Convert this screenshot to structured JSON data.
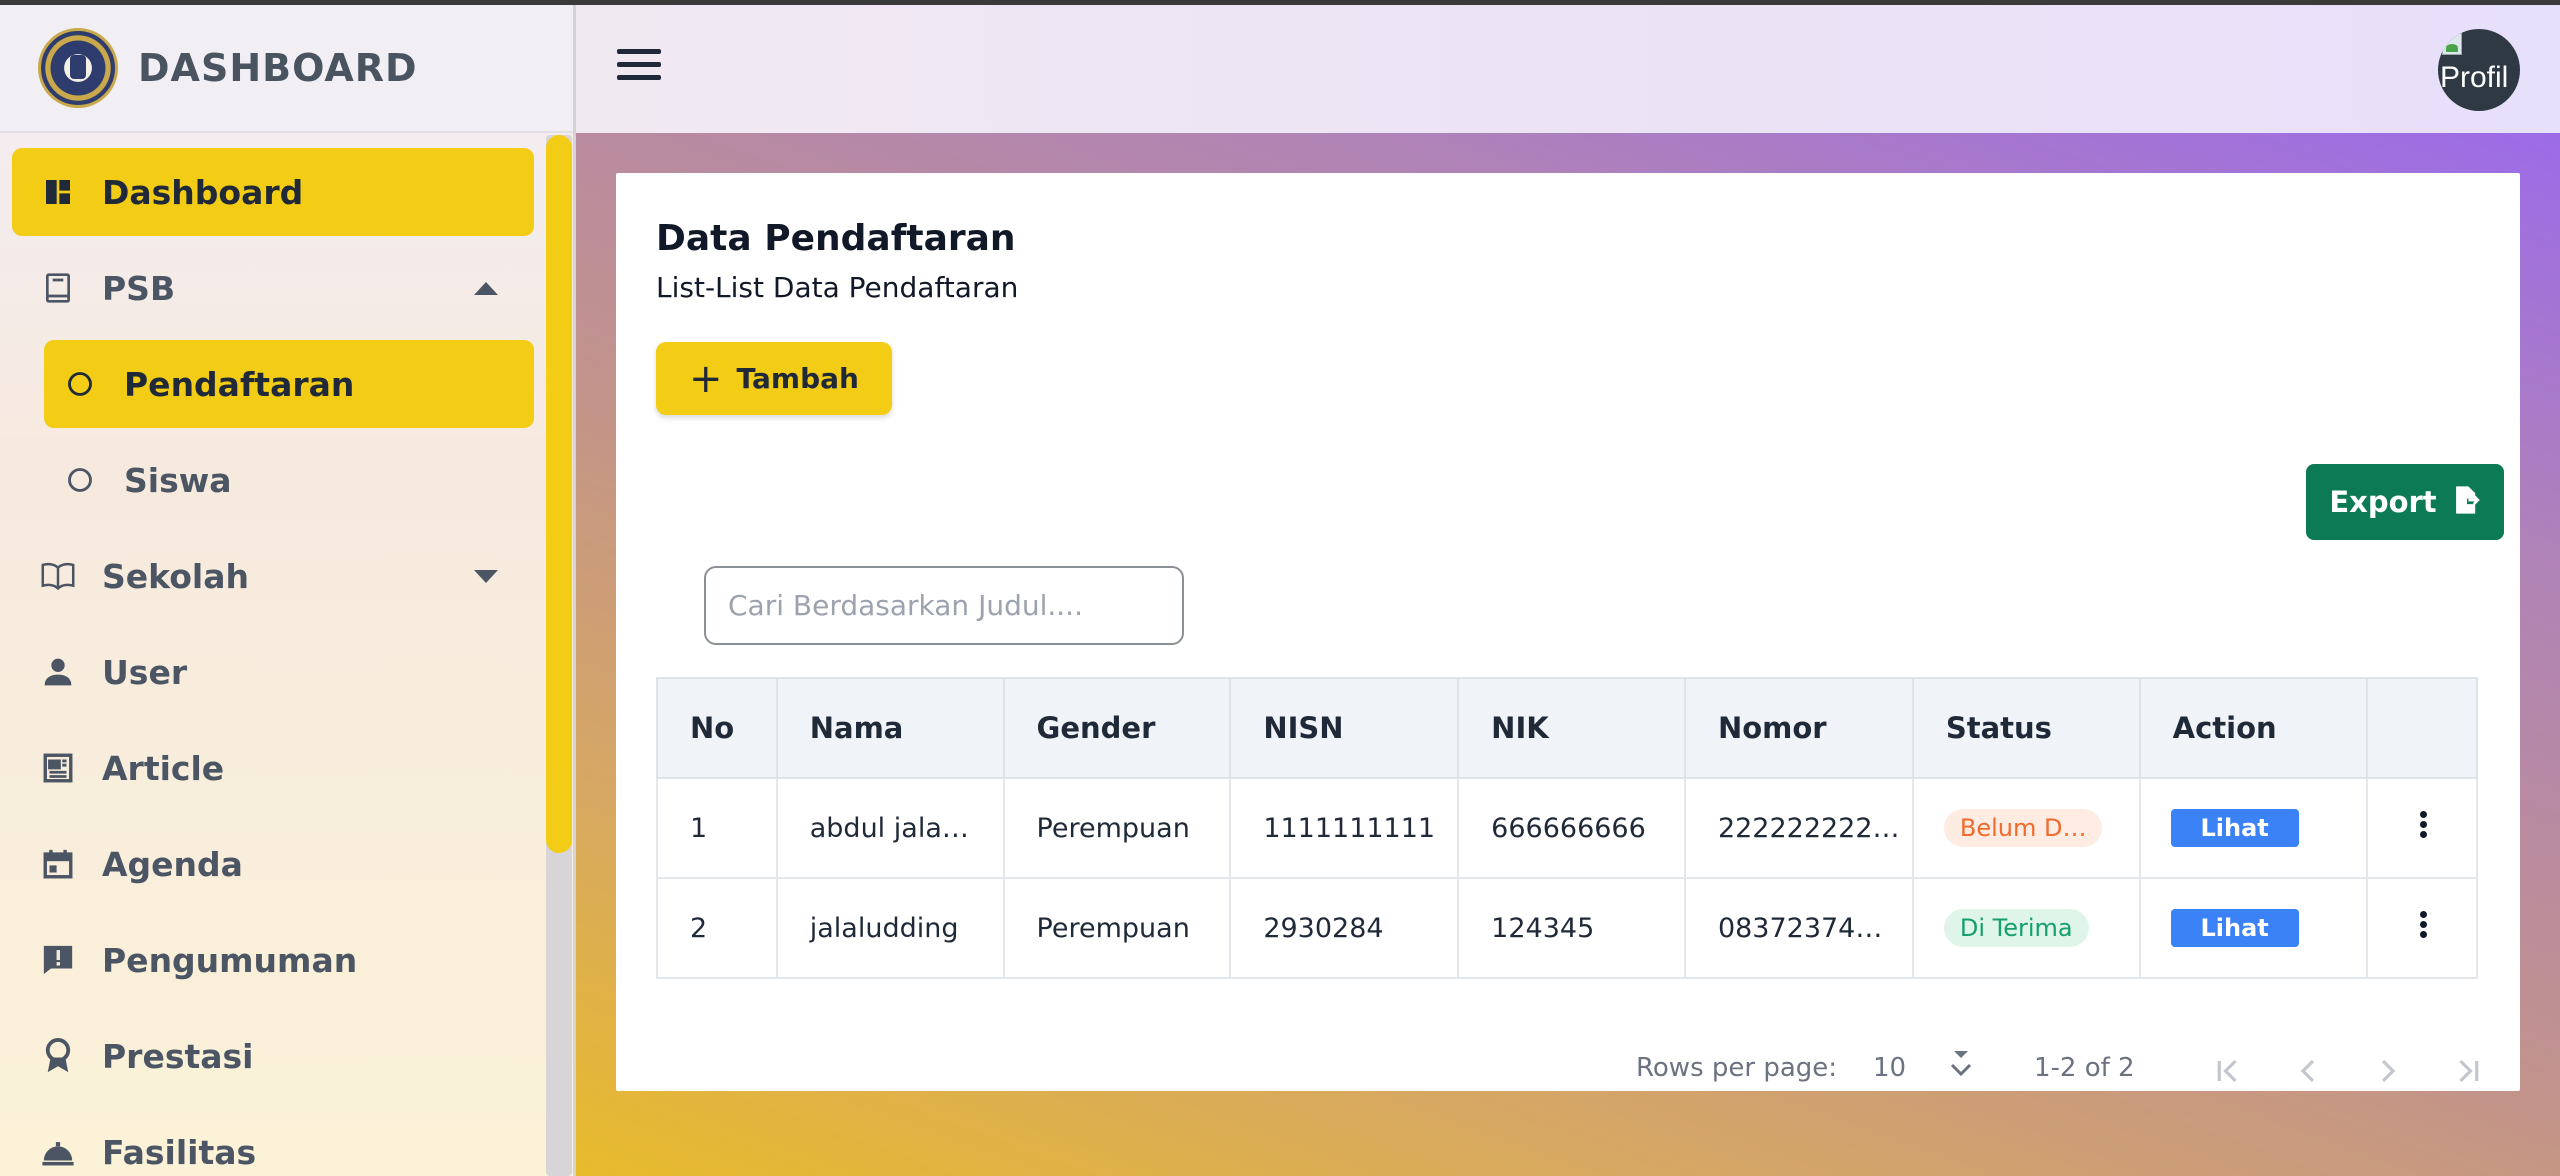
{
  "brand": {
    "title": "DASHBOARD"
  },
  "sidebar": {
    "items": [
      {
        "label": "Dashboard",
        "icon": "dashboard-icon",
        "active": true
      },
      {
        "label": "PSB",
        "icon": "book-icon",
        "expanded": true
      },
      {
        "label": "Pendaftaran",
        "icon": "circle-icon",
        "active": true,
        "sub": true
      },
      {
        "label": "Siswa",
        "icon": "circle-icon",
        "sub": true
      },
      {
        "label": "Sekolah",
        "icon": "open-book-icon",
        "expanded": false
      },
      {
        "label": "User",
        "icon": "person-icon"
      },
      {
        "label": "Article",
        "icon": "newspaper-icon"
      },
      {
        "label": "Agenda",
        "icon": "calendar-icon"
      },
      {
        "label": "Pengumuman",
        "icon": "announcement-icon"
      },
      {
        "label": "Prestasi",
        "icon": "award-icon"
      },
      {
        "label": "Fasilitas",
        "icon": "service-bell-icon"
      }
    ]
  },
  "header": {
    "avatar_alt": "Profil"
  },
  "main": {
    "title": "Data Pendaftaran",
    "subtitle": "List-List Data Pendaftaran",
    "add_button": "Tambah",
    "export_button": "Export",
    "search_placeholder": "Cari Berdasarkan Judul....",
    "table": {
      "headers": [
        "No",
        "Nama",
        "Gender",
        "NISN",
        "NIK",
        "Nomor",
        "Status",
        "Action",
        ""
      ],
      "rows": [
        {
          "no": "1",
          "nama": "abdul jala…",
          "gender": "Perempuan",
          "nisn": "1111111111",
          "nik": "666666666",
          "nomor": "222222222…",
          "status": "Belum D…",
          "action": "Lihat"
        },
        {
          "no": "2",
          "nama": "jalaludding",
          "gender": "Perempuan",
          "nisn": "2930284",
          "nik": "124345",
          "nomor": "08372374…",
          "status": "Di Terima",
          "action": "Lihat"
        }
      ]
    },
    "pagination": {
      "rows_per_page_label": "Rows per page:",
      "rows_per_page": "10",
      "range": "1-2 of 2"
    }
  },
  "colors": {
    "accent": "#f3cd15",
    "export": "#0b7a55",
    "lihat": "#3b82f6"
  }
}
